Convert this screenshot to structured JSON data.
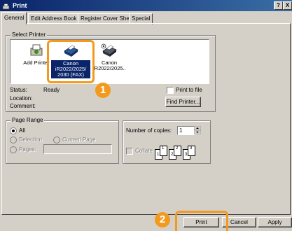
{
  "window": {
    "title": "Print",
    "help_btn": "?",
    "close_btn": "X"
  },
  "tabs": [
    {
      "label": "General"
    },
    {
      "label": "Edit Address Book"
    },
    {
      "label": "Register Cover Sheet"
    },
    {
      "label": "Special"
    }
  ],
  "select_printer": {
    "legend": "Select Printer",
    "items": [
      {
        "label": "Add Printer",
        "icon": "add-printer-icon"
      },
      {
        "label": "Canon iR2022/2025/ 2030 (FAX)",
        "icon": "fax-printer-icon",
        "selected": true
      },
      {
        "label": "Canon iR2022/2025..",
        "icon": "printer-icon"
      }
    ]
  },
  "status": {
    "status_label": "Status:",
    "status_value": "Ready",
    "location_label": "Location:",
    "comment_label": "Comment:",
    "print_to_file": "Print to file",
    "find_printer": "Find Printer..."
  },
  "page_range": {
    "legend": "Page Range",
    "all": "All",
    "selection": "Selection",
    "current_page": "Current Page",
    "pages": "Pages:"
  },
  "copies": {
    "number_label": "Number of copies:",
    "number_value": "1",
    "collate": "Collate",
    "collate_pages": [
      "1",
      "1",
      "2",
      "2",
      "3",
      "3"
    ]
  },
  "buttons": {
    "print": "Print",
    "cancel": "Cancel",
    "apply": "Apply"
  },
  "callouts": [
    "1",
    "2"
  ],
  "colors": {
    "callout": "#f39a1e",
    "title_start": "#0a246a",
    "selection": "#0a246a"
  }
}
